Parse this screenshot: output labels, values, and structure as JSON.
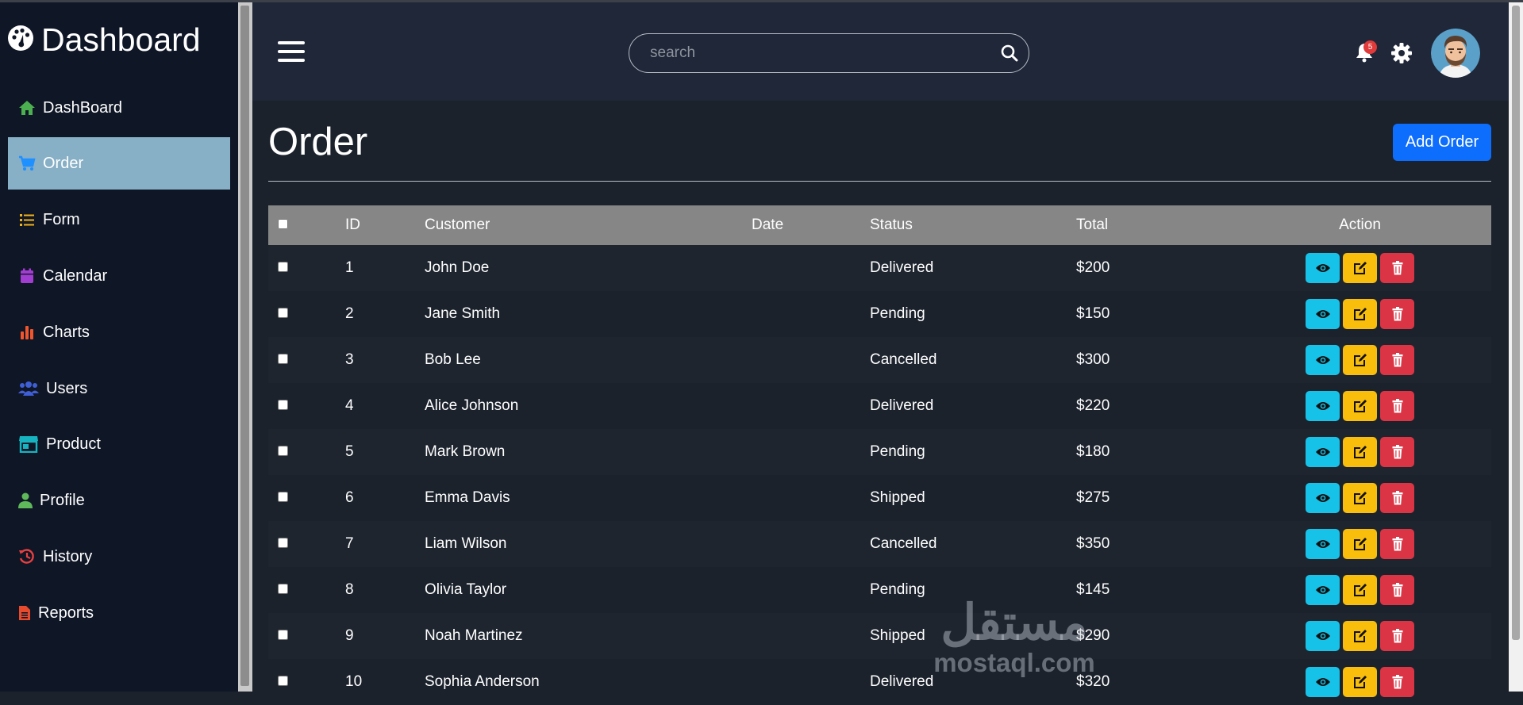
{
  "sidebar": {
    "brand": "Dashboard",
    "items": [
      {
        "label": "DashBoard",
        "icon": "home-icon",
        "color": "#4caf50"
      },
      {
        "label": "Order",
        "icon": "cart-icon",
        "color": "#1e90ff",
        "active": true
      },
      {
        "label": "Form",
        "icon": "list-icon",
        "color": "#f0b31c"
      },
      {
        "label": "Calendar",
        "icon": "calendar-icon",
        "color": "#a23dd1"
      },
      {
        "label": "Charts",
        "icon": "bar-chart-icon",
        "color": "#f0552d"
      },
      {
        "label": "Users",
        "icon": "users-icon",
        "color": "#3f5fd6"
      },
      {
        "label": "Product",
        "icon": "store-icon",
        "color": "#17b3c0"
      },
      {
        "label": "Profile",
        "icon": "user-icon",
        "color": "#5fb85a"
      },
      {
        "label": "History",
        "icon": "history-icon",
        "color": "#e84040"
      },
      {
        "label": "Reports",
        "icon": "file-icon",
        "color": "#e84a2e"
      }
    ]
  },
  "topbar": {
    "search_placeholder": "search",
    "notification_count": "5"
  },
  "page": {
    "title": "Order",
    "add_button": "Add Order"
  },
  "table": {
    "columns": [
      "ID",
      "Customer",
      "Date",
      "Status",
      "Total",
      "Action"
    ],
    "rows": [
      {
        "id": "1",
        "customer": "John Doe",
        "date": "",
        "status": "Delivered",
        "total": "$200"
      },
      {
        "id": "2",
        "customer": "Jane Smith",
        "date": "",
        "status": "Pending",
        "total": "$150"
      },
      {
        "id": "3",
        "customer": "Bob Lee",
        "date": "",
        "status": "Cancelled",
        "total": "$300"
      },
      {
        "id": "4",
        "customer": "Alice Johnson",
        "date": "",
        "status": "Delivered",
        "total": "$220"
      },
      {
        "id": "5",
        "customer": "Mark Brown",
        "date": "",
        "status": "Pending",
        "total": "$180"
      },
      {
        "id": "6",
        "customer": "Emma Davis",
        "date": "",
        "status": "Shipped",
        "total": "$275"
      },
      {
        "id": "7",
        "customer": "Liam Wilson",
        "date": "",
        "status": "Cancelled",
        "total": "$350"
      },
      {
        "id": "8",
        "customer": "Olivia Taylor",
        "date": "",
        "status": "Pending",
        "total": "$145"
      },
      {
        "id": "9",
        "customer": "Noah Martinez",
        "date": "",
        "status": "Shipped",
        "total": "$290"
      },
      {
        "id": "10",
        "customer": "Sophia Anderson",
        "date": "",
        "status": "Delivered",
        "total": "$320"
      }
    ]
  },
  "watermark": {
    "arabic": "مستقل",
    "latin": "mostaql.com"
  },
  "colors": {
    "view": "#17c2e8",
    "edit": "#f9bd0b",
    "delete": "#db3545",
    "primary": "#0d6efd",
    "active_nav": "#87afc6"
  }
}
